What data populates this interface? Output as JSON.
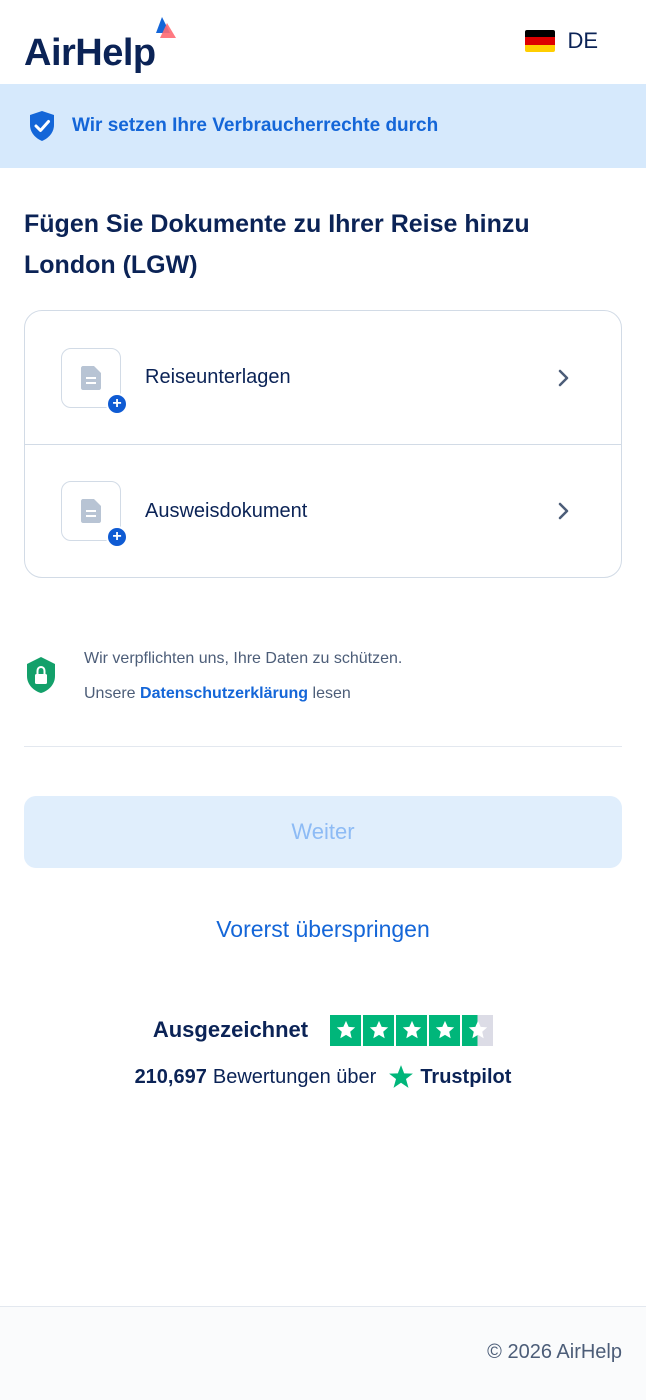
{
  "header": {
    "logo_text": "AirHelp",
    "language_code": "DE",
    "flag_colors": [
      "#000000",
      "#dd0000",
      "#ffce00"
    ]
  },
  "banner": {
    "text": "Wir setzen Ihre Verbraucherrechte durch",
    "icon": "shield-check-icon"
  },
  "page": {
    "title_line1": "Fügen Sie Dokumente zu Ihrer Reise hinzu",
    "title_line2": "London (LGW)"
  },
  "documents": [
    {
      "label": "Reiseunterlagen",
      "icon": "document-add-icon"
    },
    {
      "label": "Ausweisdokument",
      "icon": "document-add-icon"
    }
  ],
  "privacy": {
    "line1": "Wir verpflichten uns, Ihre Daten zu schützen.",
    "line2_prefix": "Unsere",
    "link": "Datenschutzerklärung",
    "line2_suffix": "lesen",
    "icon": "lock-shield-icon"
  },
  "actions": {
    "continue_label": "Weiter",
    "skip_label": "Vorerst überspringen"
  },
  "trustpilot": {
    "rating_label": "Ausgezeichnet",
    "stars": 4.5,
    "review_count": "210,697",
    "reviews_text": "Bewertungen über",
    "brand": "Trustpilot"
  },
  "footer": {
    "copyright": "© 2026 AirHelp"
  },
  "colors": {
    "brand_navy": "#0b2356",
    "accent_blue": "#1466d8",
    "banner_bg": "#d6e9fc",
    "trustpilot_green": "#00b67a",
    "privacy_green": "#13a06a"
  }
}
